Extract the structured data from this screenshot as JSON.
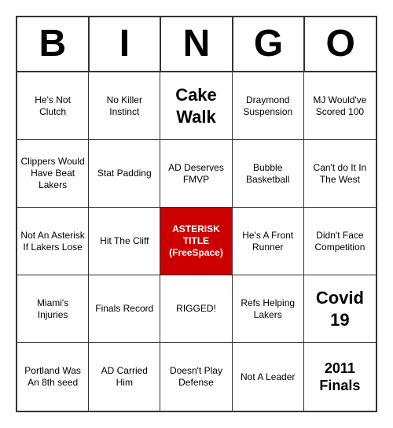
{
  "header": {
    "letters": [
      "B",
      "I",
      "N",
      "G",
      "O"
    ]
  },
  "cells": [
    {
      "text": "He's Not Clutch",
      "style": ""
    },
    {
      "text": "No Killer Instinct",
      "style": ""
    },
    {
      "text": "Cake Walk",
      "style": "large-text"
    },
    {
      "text": "Draymond Suspension",
      "style": ""
    },
    {
      "text": "MJ Would've Scored 100",
      "style": ""
    },
    {
      "text": "Clippers Would Have Beat Lakers",
      "style": ""
    },
    {
      "text": "Stat Padding",
      "style": ""
    },
    {
      "text": "AD Deserves FMVP",
      "style": ""
    },
    {
      "text": "Bubble Basketball",
      "style": ""
    },
    {
      "text": "Can't do It In The West",
      "style": ""
    },
    {
      "text": "Not An Asterisk If Lakers Lose",
      "style": ""
    },
    {
      "text": "Hit The Cliff",
      "style": ""
    },
    {
      "text": "ASTERISK TITLE (FreeSpace)",
      "style": "free-space"
    },
    {
      "text": "He's A Front Runner",
      "style": ""
    },
    {
      "text": "Didn't Face Competition",
      "style": ""
    },
    {
      "text": "Miami's Injuries",
      "style": ""
    },
    {
      "text": "Finals Record",
      "style": ""
    },
    {
      "text": "RIGGED!",
      "style": ""
    },
    {
      "text": "Refs Helping Lakers",
      "style": ""
    },
    {
      "text": "Covid 19",
      "style": "large-text"
    },
    {
      "text": "Portland Was An 8th seed",
      "style": ""
    },
    {
      "text": "AD Carried Him",
      "style": ""
    },
    {
      "text": "Doesn't Play Defense",
      "style": ""
    },
    {
      "text": "Not A Leader",
      "style": ""
    },
    {
      "text": "2011 Finals",
      "style": "medium-large"
    }
  ]
}
